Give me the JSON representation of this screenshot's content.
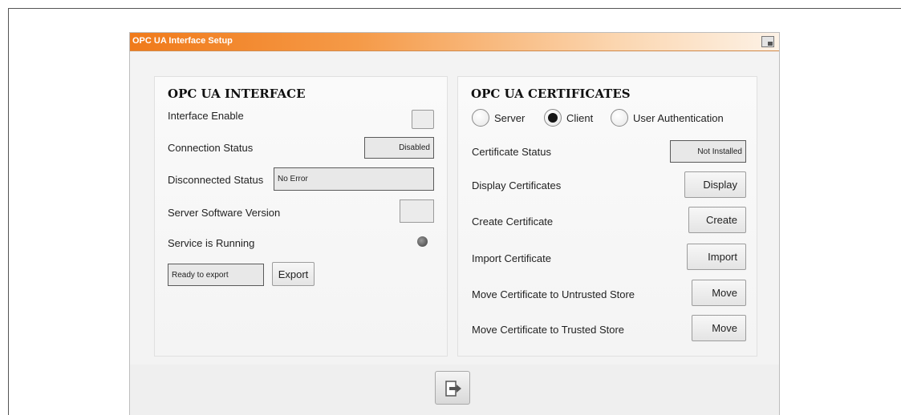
{
  "window": {
    "title": "OPC UA Interface Setup",
    "title_icon": "window-restore-icon"
  },
  "interface": {
    "heading": "OPC UA INTERFACE",
    "interface_enable_label": "Interface Enable",
    "interface_enabled": false,
    "connection_status_label": "Connection Status",
    "connection_status_value": "Disabled",
    "disconnected_status_label": "Disconnected Status",
    "disconnected_status_value": "No Error",
    "server_version_label": "Server Software Version",
    "server_version_value": "",
    "service_running_label": "Service is Running",
    "service_running_led_color": "#5a5a5a",
    "export_status_value": "Ready to export",
    "export_button": "Export"
  },
  "certificates": {
    "heading": "OPC UA CERTIFICATES",
    "radios": [
      {
        "label": "Server",
        "selected": false
      },
      {
        "label": "Client",
        "selected": true
      },
      {
        "label": "User Authentication",
        "selected": false
      }
    ],
    "certificate_status_label": "Certificate Status",
    "certificate_status_value": "Not Installed",
    "display_label": "Display Certificates",
    "display_button": "Display",
    "create_label": "Create Certificate",
    "create_button": "Create",
    "import_label": "Import Certificate",
    "import_button": "Import",
    "move_untrusted_label": "Move Certificate to Untrusted Store",
    "move_untrusted_button": "Move",
    "move_trusted_label": "Move Certificate to Trusted Store",
    "move_trusted_button": "Move"
  },
  "footer": {
    "exit_icon": "exit-door-icon"
  },
  "colors": {
    "titlebar_accent": "#f07a1a",
    "panel_background": "#f7f7f7"
  }
}
